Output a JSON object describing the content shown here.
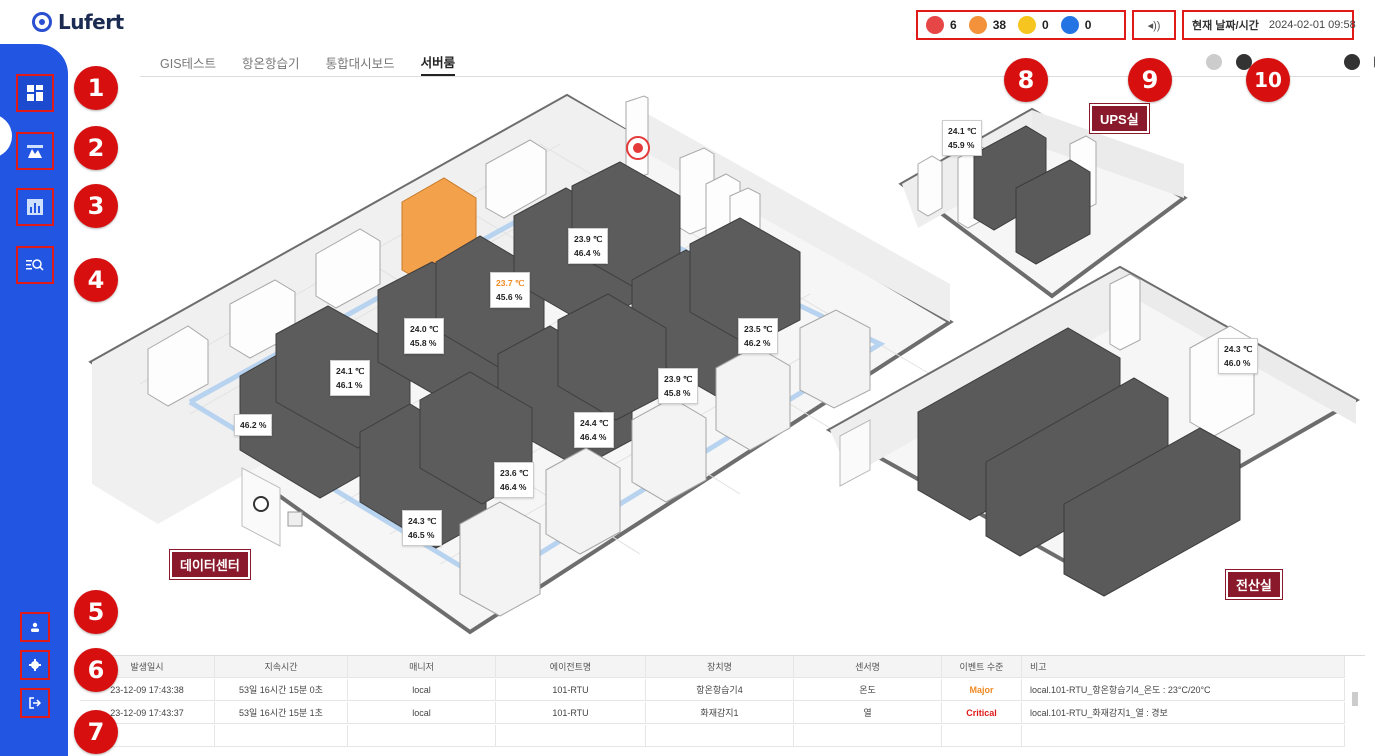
{
  "app": {
    "logo": "Lufert"
  },
  "alarms": [
    {
      "count": "6",
      "color": "#e64646"
    },
    {
      "count": "38",
      "color": "#f3923a"
    },
    {
      "count": "0",
      "color": "#f7c51f"
    },
    {
      "count": "0",
      "color": "#2475e3"
    }
  ],
  "sound": {
    "icon": "speaker-icon",
    "glyph": "◂))"
  },
  "datetime": {
    "label": "현재 날짜/시간",
    "value": "2024-02-01 09:58"
  },
  "sidebar": {
    "items": [
      {
        "name": "dashboard",
        "icon": "dashboard-icon"
      },
      {
        "name": "map",
        "icon": "map-icon"
      },
      {
        "name": "report",
        "icon": "chart-icon"
      },
      {
        "name": "search",
        "icon": "list-search-icon"
      }
    ],
    "bottom": [
      {
        "name": "user",
        "icon": "user-icon"
      },
      {
        "name": "settings",
        "icon": "gear-icon"
      },
      {
        "name": "logout",
        "icon": "logout-icon"
      }
    ]
  },
  "badges": [
    "1",
    "2",
    "3",
    "4",
    "5",
    "6",
    "7",
    "8",
    "9",
    "10"
  ],
  "tabs": [
    {
      "label": "GIS테스트",
      "active": false
    },
    {
      "label": "항온항습기",
      "active": false
    },
    {
      "label": "통합대시보드",
      "active": false
    },
    {
      "label": "서버룸",
      "active": true
    }
  ],
  "rooms": {
    "datacenter": "데이터센터",
    "ups": "UPS실",
    "it": "전산실"
  },
  "sensors": [
    {
      "temp": "23.9 ℃",
      "hum": "46.4 %"
    },
    {
      "temp": "23.7 ℃",
      "hum": "45.6 %",
      "warn": true
    },
    {
      "temp": "24.0 ℃",
      "hum": "45.8 %"
    },
    {
      "temp": "23.5 ℃",
      "hum": "46.2 %"
    },
    {
      "temp": "24.1 ℃",
      "hum": "46.1 %"
    },
    {
      "temp": "23.9 ℃",
      "hum": "45.8 %"
    },
    {
      "temp": "",
      "hum": "46.2 %"
    },
    {
      "temp": "24.4 ℃",
      "hum": "46.4 %"
    },
    {
      "temp": "23.6 ℃",
      "hum": "46.4 %"
    },
    {
      "temp": "24.3 ℃",
      "hum": "46.5 %"
    },
    {
      "temp": "24.1 ℃",
      "hum": "45.9 %"
    },
    {
      "temp": "24.3 ℃",
      "hum": "46.0 %"
    }
  ],
  "events": {
    "headers": [
      "발생일시",
      "지속시간",
      "매니저",
      "에이전트명",
      "장치명",
      "센서명",
      "이벤트 수준",
      "비고"
    ],
    "rows": [
      [
        "23-12-09 17:43:38",
        "53일 16시간 15분 0초",
        "local",
        "101-RTU",
        "항온항습기4",
        "온도",
        "Major",
        "local.101-RTU_항온항습기4_온도 : 23°C/20°C"
      ],
      [
        "23-12-09 17:43:37",
        "53일 16시간 15분 1초",
        "local",
        "101-RTU",
        "화재감지1",
        "열",
        "Critical",
        "local.101-RTU_화재감지1_열 : 경보"
      ]
    ]
  }
}
